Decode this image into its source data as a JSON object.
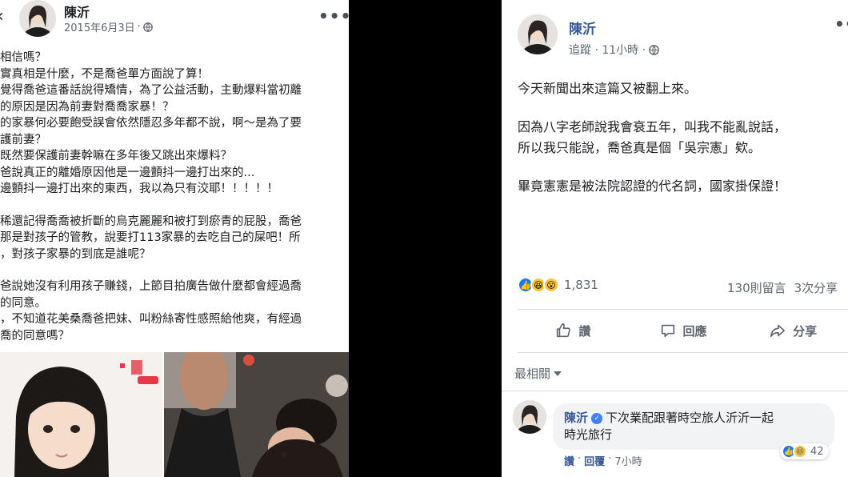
{
  "left_post": {
    "author": "陳沂",
    "date": "2015年6月3日",
    "dot": "·",
    "more": "•••",
    "lines": [
      "相信嗎？",
      "實真相是什麼，不是喬爸單方面說了算！",
      "覺得喬爸這番話說得矯情，為了公益活動，主動爆料當初離",
      "的原因是因為前妻對喬喬家暴！？",
      "的家暴何必要飽受誤會依然隱忍多年都不說，啊～是為了要",
      "護前妻？",
      "既然要保護前妻幹嘛在多年後又跳出來爆料？",
      "爸說真正的離婚原因他是一邊顫抖一邊打出來的...",
      "邊顫抖一邊打出來的東西，我以為只有洨耶！！！！！",
      "稀還記得喬喬被折斷的烏克麗麗和被打到瘀青的屁股，喬爸",
      "那是對孩子的管教，說要打113家暴的去吃自己的屎吧！所",
      "，對孩子家暴的到底是誰呢？",
      "爸說她沒有利用孩子賺錢，上節目拍廣告做什麼都會經過喬",
      "的同意。",
      "，不知道花美桑喬爸把妹、叫粉絲寄性感照給他爽，有經過",
      "喬的同意嗎？"
    ]
  },
  "right_post": {
    "author": "陳沂",
    "meta": "追蹤 · 11小時 ·",
    "more": "•••",
    "paragraphs": [
      [
        "今天新聞出來這篇又被翻上來。"
      ],
      [
        "因為八字老師說我會衰五年，叫我不能亂說話，",
        "所以我只能說，喬爸真是個「吳宗憲」欸。"
      ],
      [
        "畢竟憲憲是被法院認證的代名詞，國家掛保證！"
      ]
    ],
    "reaction_count": "1,831",
    "comments_count": "130則留言",
    "shares_count": "3次分享",
    "actions": {
      "like": "讚",
      "comment": "回應",
      "share": "分享"
    },
    "sort_label": "最相關",
    "comment": {
      "author": "陳沂",
      "text_line1": "下次業配跟著時空旅人沂沂一起",
      "text_line2": "時光旅行",
      "like": "讚",
      "reply": "回覆",
      "dot": "·",
      "time": "7小時",
      "reaction_count": "42"
    }
  },
  "colors": {
    "link": "#385898",
    "facebook_blue": "#1877f2",
    "muted": "#606770",
    "panel_gap": "#000000"
  }
}
